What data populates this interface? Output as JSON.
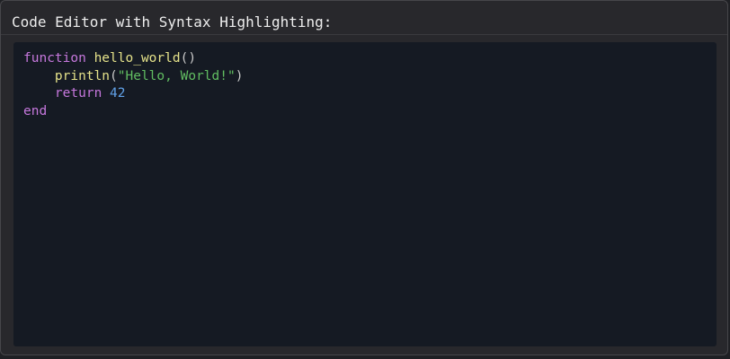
{
  "window": {
    "title": "Code Editor with Syntax Highlighting:"
  },
  "editor": {
    "language_colors": {
      "keyword": "#c678dd",
      "function": "#e5e28a",
      "string": "#61bd61",
      "number": "#61a2e8",
      "punctuation": "#c8c8c8",
      "background": "#151a23"
    },
    "lines": [
      {
        "tokens": [
          {
            "type": "keyword",
            "text": "function"
          },
          {
            "type": "plain",
            "text": " "
          },
          {
            "type": "function",
            "text": "hello_world"
          },
          {
            "type": "punct",
            "text": "()"
          }
        ]
      },
      {
        "tokens": [
          {
            "type": "plain",
            "text": "    "
          },
          {
            "type": "function",
            "text": "println"
          },
          {
            "type": "punct",
            "text": "("
          },
          {
            "type": "string",
            "text": "\"Hello, World!\""
          },
          {
            "type": "punct",
            "text": ")"
          }
        ]
      },
      {
        "tokens": [
          {
            "type": "plain",
            "text": "    "
          },
          {
            "type": "keyword",
            "text": "return"
          },
          {
            "type": "plain",
            "text": " "
          },
          {
            "type": "number",
            "text": "42"
          }
        ]
      },
      {
        "tokens": [
          {
            "type": "keyword",
            "text": "end"
          }
        ]
      }
    ]
  }
}
